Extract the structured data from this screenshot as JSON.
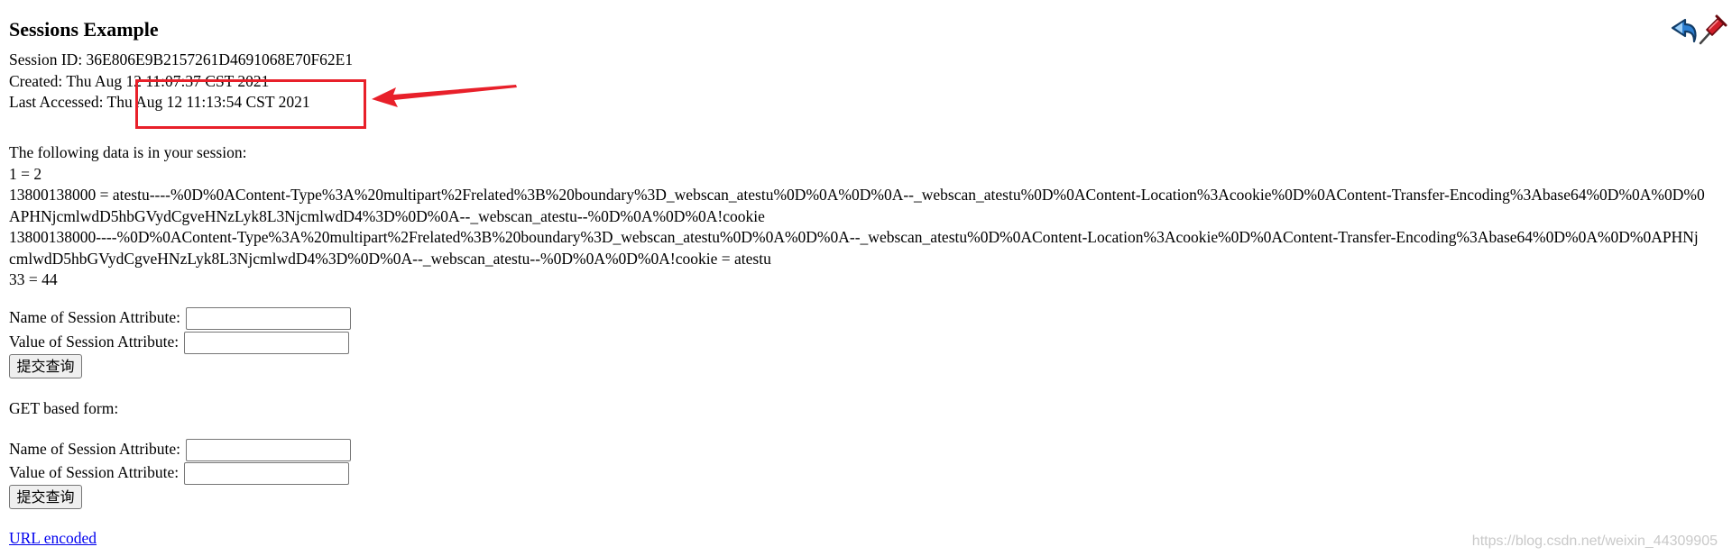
{
  "page": {
    "title": "Sessions Example"
  },
  "session_info": {
    "id_line": "Session ID: 36E806E9B2157261D4691068E70F62E1",
    "created_line": "Created: Thu Aug 12 11:07:37 CST 2021",
    "last_accessed_line": "Last Accessed: Thu Aug 12 11:13:54 CST 2021"
  },
  "session_data": {
    "intro": "The following data is in your session:",
    "entries": [
      "1 = 2",
      "13800138000 = atestu----%0D%0AContent-Type%3A%20multipart%2Frelated%3B%20boundary%3D_webscan_atestu%0D%0A%0D%0A--_webscan_atestu%0D%0AContent-Location%3Acookie%0D%0AContent-Transfer-Encoding%3Abase64%0D%0A%0D%0APHNjcmlwdD5hbGVydCgveHNzLyk8L3NjcmlwdD4%3D%0D%0A--_webscan_atestu--%0D%0A%0D%0A!cookie",
      "13800138000----%0D%0AContent-Type%3A%20multipart%2Frelated%3B%20boundary%3D_webscan_atestu%0D%0A%0D%0A--_webscan_atestu%0D%0AContent-Location%3Acookie%0D%0AContent-Transfer-Encoding%3Abase64%0D%0A%0D%0APHNjcmlwdD5hbGVydCgveHNzLyk8L3NjcmlwdD4%3D%0D%0A--_webscan_atestu--%0D%0A%0D%0A!cookie = atestu",
      "33 = 44"
    ]
  },
  "post_form": {
    "name_label": "Name of Session Attribute:",
    "name_value": "",
    "value_label": "Value of Session Attribute:",
    "value_value": "",
    "submit_label": "提交查询"
  },
  "get_form": {
    "heading": "GET based form:",
    "name_label": "Name of Session Attribute:",
    "name_value": "",
    "value_label": "Value of Session Attribute:",
    "value_value": "",
    "submit_label": "提交查询"
  },
  "footer": {
    "link_label": "URL encoded"
  },
  "toolbar": {
    "back_icon": "back-arrow-icon",
    "pin_icon": "pushpin-icon"
  },
  "annotation": {
    "color": "#e8202a"
  },
  "watermark": {
    "text": "https://blog.csdn.net/weixin_44309905"
  }
}
